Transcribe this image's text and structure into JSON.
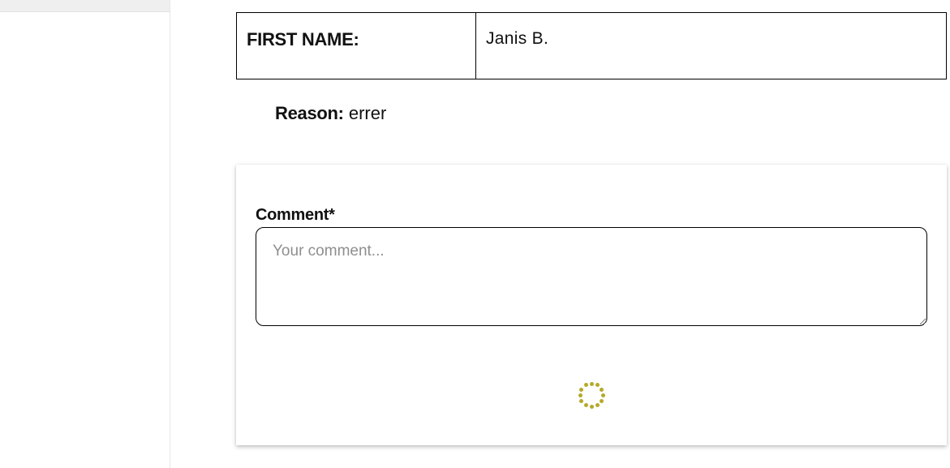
{
  "sidebar": {},
  "details": {
    "first_name_label": "FIRST NAME:",
    "first_name_value": "Janis B."
  },
  "reason": {
    "label": "Reason:",
    "value": "errer"
  },
  "comment": {
    "label": "Comment*",
    "placeholder": "Your comment...",
    "value": ""
  },
  "spinner": {
    "icon": "loading-spinner-icon",
    "color": "#b5a92a"
  }
}
